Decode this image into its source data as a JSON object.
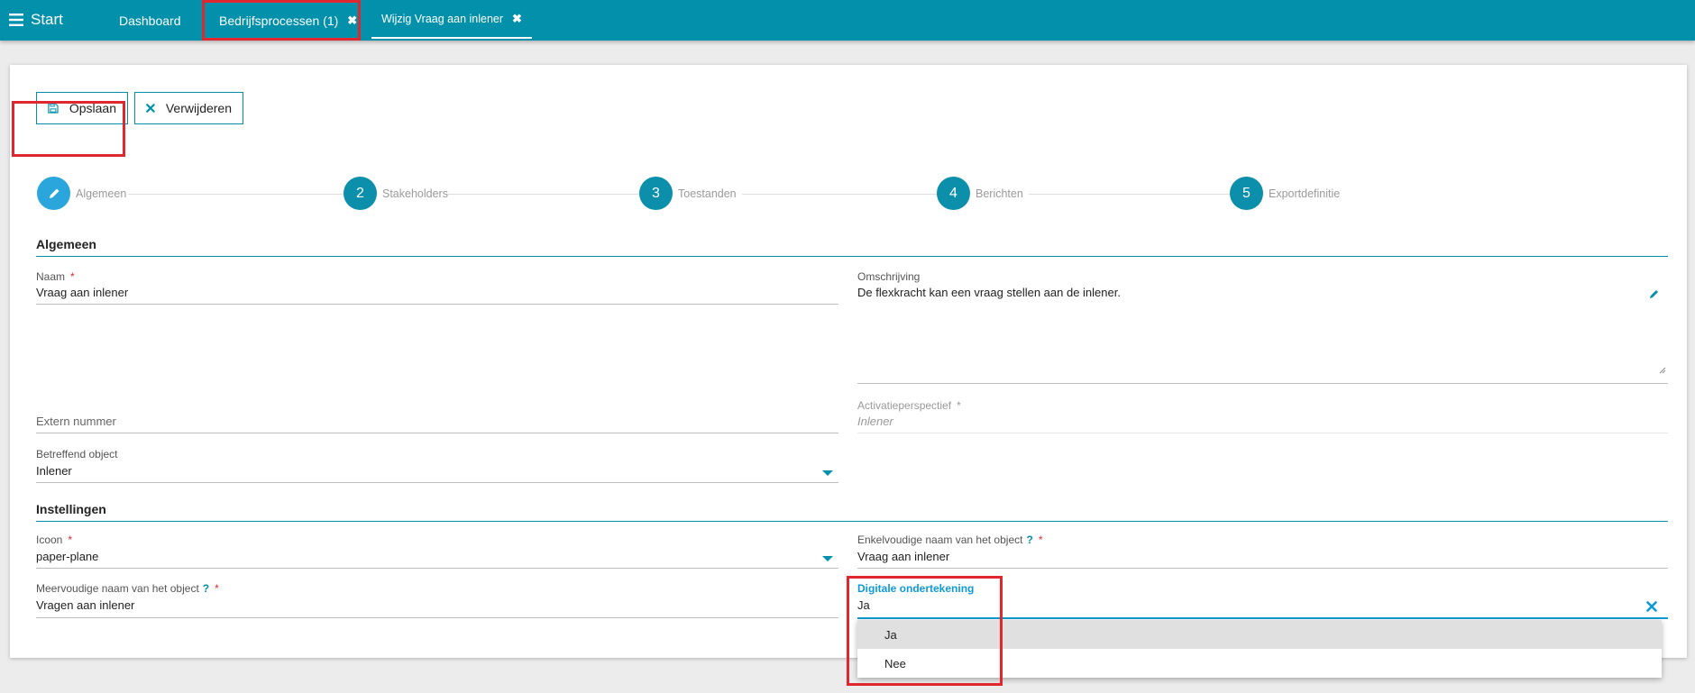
{
  "topbar": {
    "menu_label": "Start",
    "tabs": [
      {
        "label": "Dashboard"
      },
      {
        "label": "Bedrijfsprocessen (1)",
        "close": "✖"
      },
      {
        "label": "Wijzig Vraag aan inlener",
        "close": "✖"
      }
    ]
  },
  "toolbar": {
    "save_label": "Opslaan",
    "delete_label": "Verwijderen"
  },
  "steps": [
    {
      "number": "",
      "label": "Algemeen",
      "active": true
    },
    {
      "number": "2",
      "label": "Stakeholders"
    },
    {
      "number": "3",
      "label": "Toestanden"
    },
    {
      "number": "4",
      "label": "Berichten"
    },
    {
      "number": "5",
      "label": "Exportdefinitie"
    }
  ],
  "algemeen": {
    "title": "Algemeen",
    "naam": {
      "label": "Naam",
      "required": "*",
      "value": "Vraag aan inlener"
    },
    "omschrijving": {
      "label": "Omschrijving",
      "value": "De flexkracht kan een vraag stellen aan de inlener."
    },
    "extern_nummer": {
      "placeholder": "Extern nummer"
    },
    "activatieperspectief": {
      "label": "Activatieperspectief",
      "required": "*",
      "value": "Inlener"
    },
    "betreffend_object": {
      "label": "Betreffend object",
      "value": "Inlener"
    }
  },
  "instellingen": {
    "title": "Instellingen",
    "icoon": {
      "label": "Icoon",
      "required": "*",
      "value": "paper-plane"
    },
    "enkelvoudige_naam": {
      "label": "Enkelvoudige naam van het object",
      "help": "?",
      "required": "*",
      "value": "Vraag aan inlener"
    },
    "meervoudige_naam": {
      "label": "Meervoudige naam van het object",
      "help": "?",
      "required": "*",
      "value": "Vragen aan inlener"
    },
    "digitale_ondertekening": {
      "label": "Digitale ondertekening",
      "value": "Ja",
      "options": [
        "Ja",
        "Nee"
      ]
    }
  },
  "colors": {
    "primary": "#0290ab",
    "active_step": "#2aa6dd",
    "highlight": "#e0262e",
    "required": "#e0262e"
  }
}
